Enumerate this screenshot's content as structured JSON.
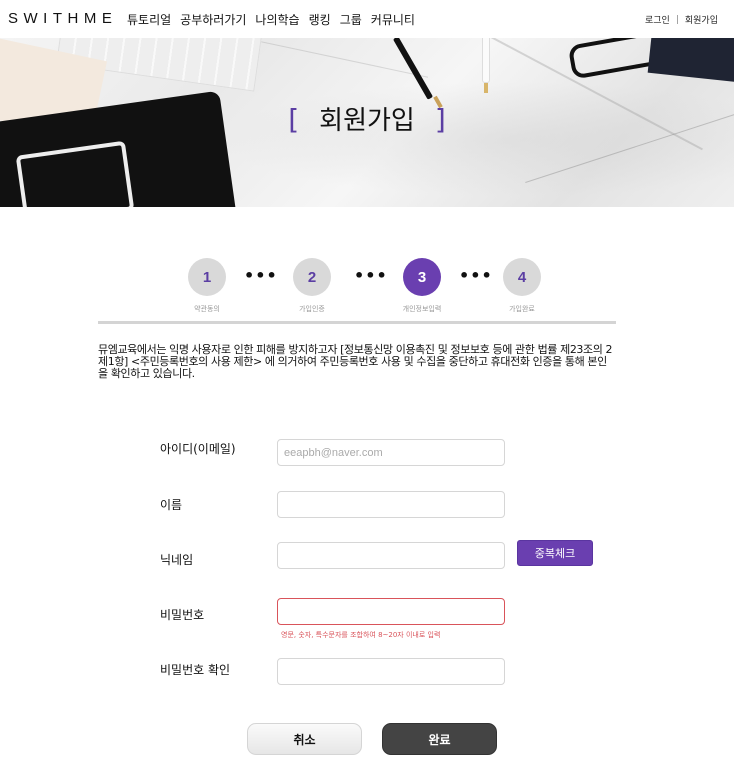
{
  "header": {
    "logo": "SWITHME",
    "nav": [
      "튜토리얼",
      "공부하러가기",
      "나의학습",
      "랭킹",
      "그룹",
      "커뮤니티"
    ],
    "login": "로그인",
    "separator": "|",
    "signup": "회원가입"
  },
  "banner": {
    "bracket_open": "[",
    "title": "회원가입",
    "bracket_close": "]"
  },
  "steps": {
    "items": [
      {
        "number": "1",
        "label": "약관동의"
      },
      {
        "number": "2",
        "label": "가입인증"
      },
      {
        "number": "3",
        "label": "개인정보입력"
      },
      {
        "number": "4",
        "label": "가입완료"
      }
    ],
    "dots": "•••",
    "active_index": 2
  },
  "notice": "뮤엠교육에서는 익명 사용자로 인한 피해를 방지하고자 [정보통신망 이용촉진 및 정보보호 등에 관한 법률 제23조의 2제1항] <주민등록번호의 사용 제한> 에 의거하여 주민등록번호 사용 및 수집을 중단하고 휴대전화 인증을 통해 본인을 확인하고 있습니다.",
  "form": {
    "id_label": "아이디(이메일)",
    "id_value": "eeapbh@naver.com",
    "name_label": "이름",
    "name_value": "",
    "nickname_label": "닉네임",
    "nickname_value": "",
    "duplicate_check": "중복체크",
    "password_label": "비밀번호",
    "password_value": "",
    "password_hint": "영문, 숫자, 특수문자를 조합하여 8~20자 이내로 입력",
    "password_confirm_label": "비밀번호 확인",
    "password_confirm_value": ""
  },
  "buttons": {
    "cancel": "취소",
    "done": "완료"
  },
  "colors": {
    "accent": "#6a3fb0",
    "error": "#d9535a",
    "dark_button": "#444444"
  }
}
